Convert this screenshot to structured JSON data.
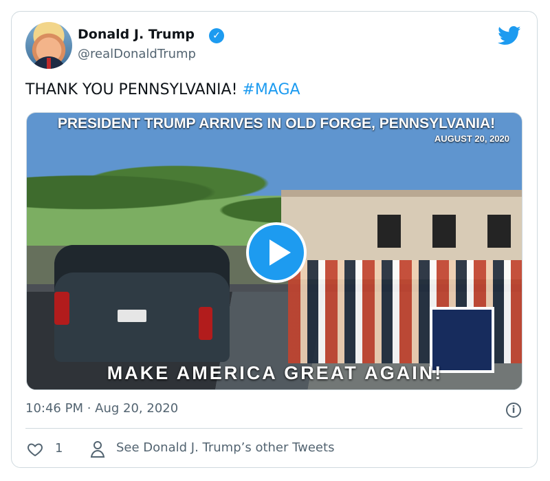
{
  "tweet": {
    "author_name": "Donald J. Trump",
    "handle": "@realDonaldTrump",
    "text": "THANK YOU PENNSYLVANIA!",
    "hashtag": "#MAGA",
    "timestamp": "10:46 PM · Aug 20, 2020",
    "likes": "1",
    "other_tweets_label": "See Donald J. Trump’s other Tweets"
  },
  "media": {
    "overlay_title": "PRESIDENT TRUMP ARRIVES IN OLD FORGE, PENNSYLVANIA!",
    "overlay_date": "AUGUST 20, 2020",
    "overlay_bottom": "MAKE AMERICA GREAT AGAIN!"
  },
  "icons": {
    "verified": "verified-badge-icon",
    "brand": "twitter-bird-icon",
    "play": "play-icon",
    "info": "info-icon",
    "like": "heart-icon",
    "profile": "person-icon"
  },
  "colors": {
    "accent": "#1d9bf0",
    "text": "#0f1419",
    "secondary": "#536471",
    "border": "#cfd9de"
  }
}
